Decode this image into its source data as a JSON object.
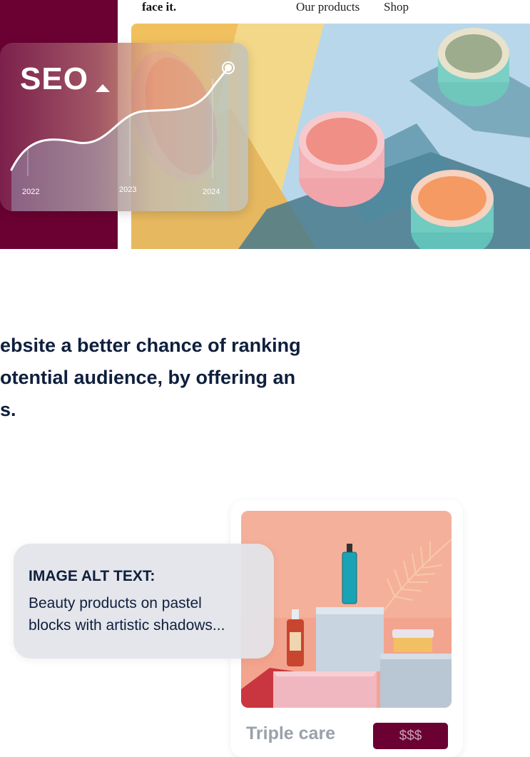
{
  "nav": {
    "logo": "face it.",
    "links": [
      "Our products",
      "Shop"
    ]
  },
  "seo_card": {
    "title": "SEO",
    "years": [
      "2022",
      "2023",
      "2024"
    ],
    "trend": "rising"
  },
  "headline": {
    "lines": [
      "ebsite a better chance of ranking",
      "otential audience, by offering an",
      "s."
    ]
  },
  "alt_text_card": {
    "title": "IMAGE ALT TEXT:",
    "description_lines": [
      "Beauty products on pastel",
      "blocks with artistic shadows..."
    ]
  },
  "product_card": {
    "name": "Triple care",
    "price_label": "$$$"
  },
  "colors": {
    "brand_maroon": "#6b0032",
    "text_navy": "#0f1f3d",
    "product_name_gray": "#9aa1aa"
  }
}
